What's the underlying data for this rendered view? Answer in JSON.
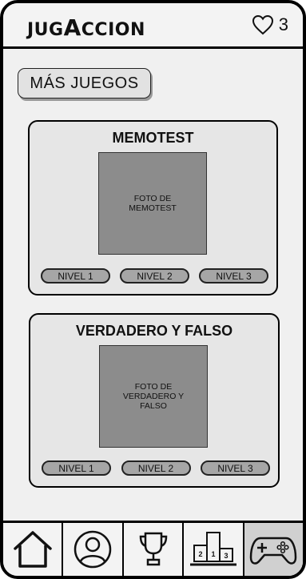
{
  "header": {
    "logo_small_1": "JUG",
    "logo_big": "A",
    "logo_small_2": "CCION",
    "lives_count": "3",
    "lives_icon": "heart-icon"
  },
  "more_games_label": "MÁS JUEGOS",
  "games": [
    {
      "title": "MEMOTEST",
      "photo_label": "FOTO DE MEMOTEST",
      "levels": [
        "NIVEL 1",
        "NIVEL 2",
        "NIVEL 3"
      ]
    },
    {
      "title": "VERDADERO Y FALSO",
      "photo_label": "FOTO DE VERDADERO Y FALSO",
      "levels": [
        "NIVEL 1",
        "NIVEL 2",
        "NIVEL 3"
      ]
    }
  ],
  "bottom_nav": {
    "items": [
      "home-icon",
      "profile-icon",
      "trophy-icon",
      "podium-icon",
      "gamepad-icon"
    ],
    "active": "gamepad-icon",
    "podium_numbers": [
      "2",
      "1",
      "3"
    ]
  }
}
